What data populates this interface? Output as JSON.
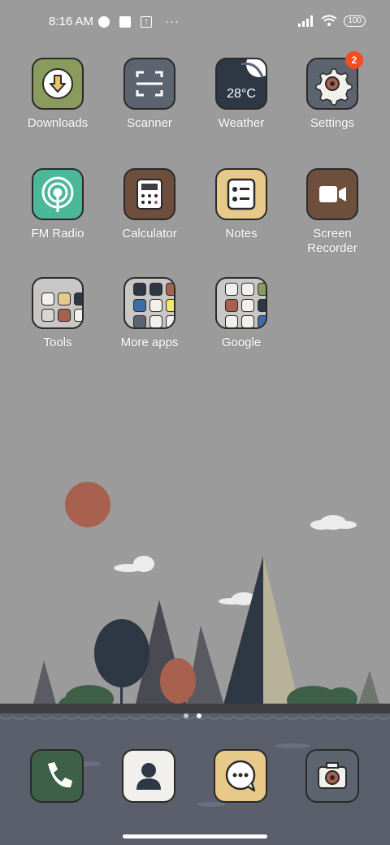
{
  "status_bar": {
    "time": "8:16 AM",
    "more": "···",
    "battery": "100"
  },
  "apps": [
    {
      "name": "Downloads",
      "icon": "download-icon"
    },
    {
      "name": "Scanner",
      "icon": "scanner-icon"
    },
    {
      "name": "Weather",
      "icon": "weather-icon",
      "temperature": "28°C"
    },
    {
      "name": "Settings",
      "icon": "gear-icon",
      "badge": "2"
    },
    {
      "name": "FM Radio",
      "icon": "radio-icon"
    },
    {
      "name": "Calculator",
      "icon": "calculator-icon"
    },
    {
      "name": "Notes",
      "icon": "notes-icon"
    },
    {
      "name": "Screen Recorder",
      "icon": "video-camera-icon"
    }
  ],
  "folders": [
    {
      "name": "Tools"
    },
    {
      "name": "More apps"
    },
    {
      "name": "Google"
    }
  ],
  "dock": [
    {
      "name": "phone",
      "icon": "phone-icon"
    },
    {
      "name": "contacts",
      "icon": "contacts-icon"
    },
    {
      "name": "messages",
      "icon": "messages-icon"
    },
    {
      "name": "camera",
      "icon": "camera-icon"
    }
  ],
  "page_indicator": {
    "pages": 2,
    "current": 2
  },
  "colors": {
    "background": "#9b9b9b",
    "badge": "#f24d1e",
    "ground": "#5a5f6b"
  }
}
